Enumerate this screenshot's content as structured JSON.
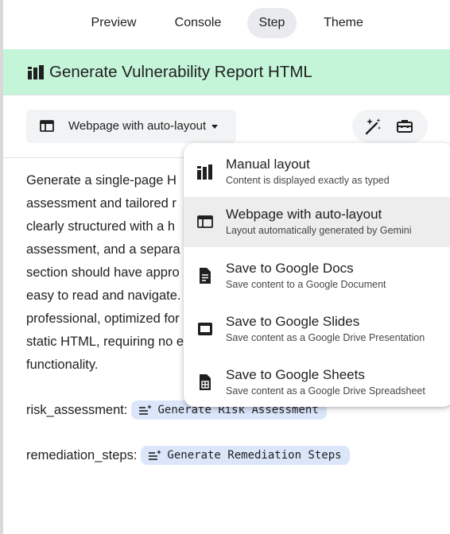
{
  "tabs": [
    {
      "label": "Preview"
    },
    {
      "label": "Console"
    },
    {
      "label": "Step"
    },
    {
      "label": "Theme"
    }
  ],
  "active_tab": "Step",
  "header": {
    "title": "Generate Vulnerability Report HTML",
    "icon": "layout-blocks-icon",
    "background": "#c5f5d8"
  },
  "toolbar": {
    "layout_select": {
      "value": "Webpage with auto-layout",
      "icon": "webpage-icon"
    },
    "magic_icon": "magic-wand-icon",
    "toolbox_icon": "toolbox-icon"
  },
  "prompt_lines": [
    "Generate a single-page H",
    "assessment and tailored r",
    "clearly structured with a h",
    "assessment, and a separa",
    "section should have appro",
    "easy to read and navigate.",
    "professional, optimized for",
    "static HTML, requiring no e",
    "functionality."
  ],
  "params": [
    {
      "label": "risk_assessment:",
      "chip": "Generate Risk Assessment"
    },
    {
      "label": "remediation_steps:",
      "chip": "Generate Remediation Steps"
    }
  ],
  "menu": {
    "items": [
      {
        "title": "Manual layout",
        "subtitle": "Content is displayed exactly as typed",
        "icon": "manual-layout-icon"
      },
      {
        "title": "Webpage with auto-layout",
        "subtitle": "Layout automatically generated by Gemini",
        "icon": "webpage-icon"
      },
      {
        "title": "Save to Google Docs",
        "subtitle": "Save content to a Google Document",
        "icon": "docs-icon"
      },
      {
        "title": "Save to Google Slides",
        "subtitle": "Save content as a Google Drive Presentation",
        "icon": "slides-icon"
      },
      {
        "title": "Save to Google Sheets",
        "subtitle": "Save content as a Google Drive Spreadsheet",
        "icon": "sheets-icon"
      }
    ],
    "selected_index": 1
  },
  "colors": {
    "chip_background": "#dbe6fb",
    "selected_item": "#ededed",
    "active_tab": "#e8eaed"
  }
}
